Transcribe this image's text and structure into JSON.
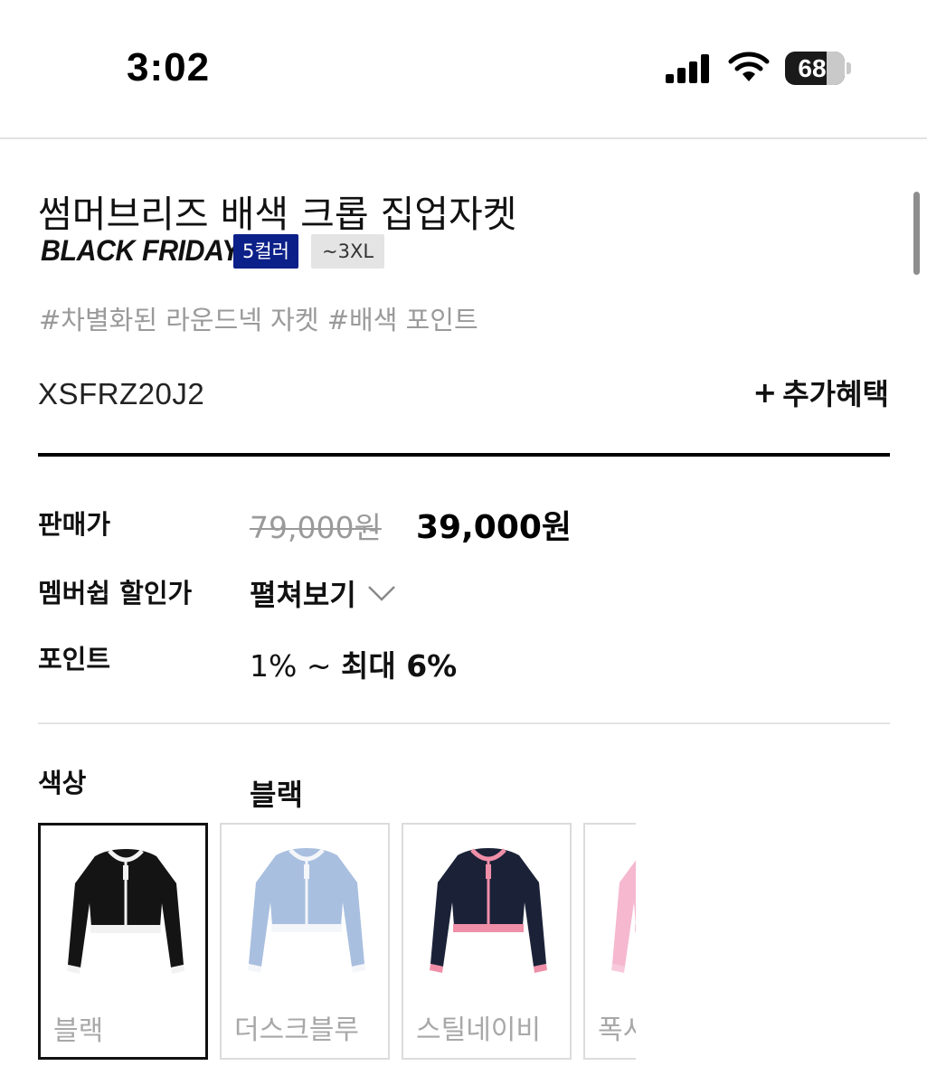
{
  "status_bar": {
    "time": "3:02",
    "battery": "68",
    "battery_level": 0.68,
    "icons": [
      "signal-icon",
      "wifi-icon",
      "battery-icon"
    ]
  },
  "product": {
    "title": "썸머브리즈 배색 크롭 집업자켓",
    "promo_badge": "BLACK FRIDAY",
    "color_count_badge": "5컬러",
    "size_badge": "~3XL",
    "hashtags": "#차별화된 라운드넥 자켓 #배색 포인트",
    "code": "XSFRZ20J2",
    "extra_benefit_label": "추가혜택",
    "extra_benefit_icon": "+"
  },
  "pricing": {
    "sale_label": "판매가",
    "original_price": "79,000원",
    "sale_price": "39,000원",
    "membership_label": "멤버쉽 할인가",
    "membership_action": "펼쳐보기",
    "point_label": "포인트",
    "point_min": "1% ~ ",
    "point_max": "최대 6%"
  },
  "color_select": {
    "label": "색상",
    "selected": "블랙",
    "options": [
      {
        "name": "블랙",
        "body": "#141414",
        "trim": "#f2f2f2",
        "selected": true
      },
      {
        "name": "더스크블루",
        "body": "#a9bfdf",
        "trim": "#f4f6fa",
        "selected": false
      },
      {
        "name": "스틸네이비",
        "body": "#1b2238",
        "trim": "#f08fa8",
        "selected": false
      },
      {
        "name": "폭시",
        "body": "#f5b8cf",
        "trim": "#f7c9da",
        "selected": false
      }
    ]
  },
  "colors": {
    "brand_badge": "#0b2088",
    "size_badge_bg": "#e4e4e4",
    "muted_text": "#9a9a9a"
  }
}
